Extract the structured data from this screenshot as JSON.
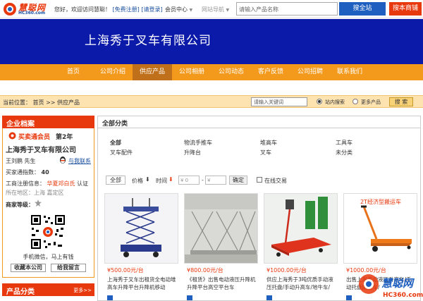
{
  "topbar": {
    "logo_text": "慧聪网",
    "logo_sub": "HC360.com",
    "welcome": "您好，欢迎访问慧聪！",
    "register": "[免费注册]",
    "login": "[请登录]",
    "member_center": "会员中心",
    "site_nav": "网站导航",
    "search_placeholder": "请输入产品名称",
    "search_all_button": "搜全站",
    "search_biz_button": "搜本商铺"
  },
  "banner": {
    "company_name": "上海秀于叉车有限公司"
  },
  "nav": {
    "items": [
      {
        "label": "首页"
      },
      {
        "label": "公司介绍"
      },
      {
        "label": "供应产品"
      },
      {
        "label": "公司相册"
      },
      {
        "label": "公司动态"
      },
      {
        "label": "客户反馈"
      },
      {
        "label": "公司招聘"
      },
      {
        "label": "联系我们"
      }
    ],
    "active_index": 2
  },
  "location": {
    "prefix": "当前位置：",
    "home": "首页",
    "sep": ">>",
    "current": "供应产品",
    "keyword_placeholder": "请输入关键词",
    "radio_in_shop": "站内搜索",
    "radio_more": "更多产品",
    "search_button": "搜 索"
  },
  "sidebar": {
    "archive_title": "企业档案",
    "member_text": "买卖通会员",
    "member_year": "第2年",
    "company_name": "上海秀于叉车有限公司",
    "contact": "王刘鹏 先生",
    "chat_link": "与我联系",
    "trust_label": "买家通指数：",
    "trust_value": "40",
    "reg_label": "工商注册信息：",
    "reg_status": "华夏邓白氏",
    "reg_suffix": "认证",
    "area": "所在地区：上海 嘉定区",
    "rank_label": "商家等级：",
    "qr_caption1": "手机微信，马上有钱",
    "qr_caption2": "手机微信，马上有钱",
    "btn_favorite": "收藏本公司",
    "btn_message": "给我留言",
    "product_cat_title": "产品分类",
    "product_cat_more": "更多>>"
  },
  "main": {
    "title": "全部分类",
    "categories": [
      {
        "label": "全部",
        "bold": true
      },
      {
        "label": "物流手推车"
      },
      {
        "label": "堆高车"
      },
      {
        "label": "工具车"
      },
      {
        "label": "叉车配件"
      },
      {
        "label": "升降台"
      },
      {
        "label": "叉车"
      },
      {
        "label": "未分类"
      }
    ],
    "filter": {
      "all": "全部",
      "price": "价格",
      "time": "时间",
      "min_placeholder": "¥ 0",
      "max_placeholder": "¥",
      "dash": "-",
      "confirm": "确定",
      "online_trade": "在线交易"
    },
    "products": [
      {
        "price": "¥500.00元/台",
        "name": "上海秀于叉车出租货全电动堆高车升降平台升降机移动"
      },
      {
        "price": "¥800.00元/台",
        "name": "《租赁》出售电动液压升降机升降平台高空平台车"
      },
      {
        "price": "¥1000.00元/台",
        "name": "供应上海秀于3吨优质手动液压托盘/手动升高车/地牛车/"
      },
      {
        "price": "¥1000.00元/台",
        "name": "出售上海手动液压升高车/手动托盘搬运车/"
      }
    ],
    "product_banner_text": "2T经济型搬运车"
  },
  "watermark": {
    "brand": "慧聪网",
    "sub": "HC360.com"
  },
  "colors": {
    "banner_blue": "#0b1aa8",
    "nav_orange": "#f39a1d",
    "accent_red": "#e8380d",
    "link_blue": "#1a4fa0"
  }
}
